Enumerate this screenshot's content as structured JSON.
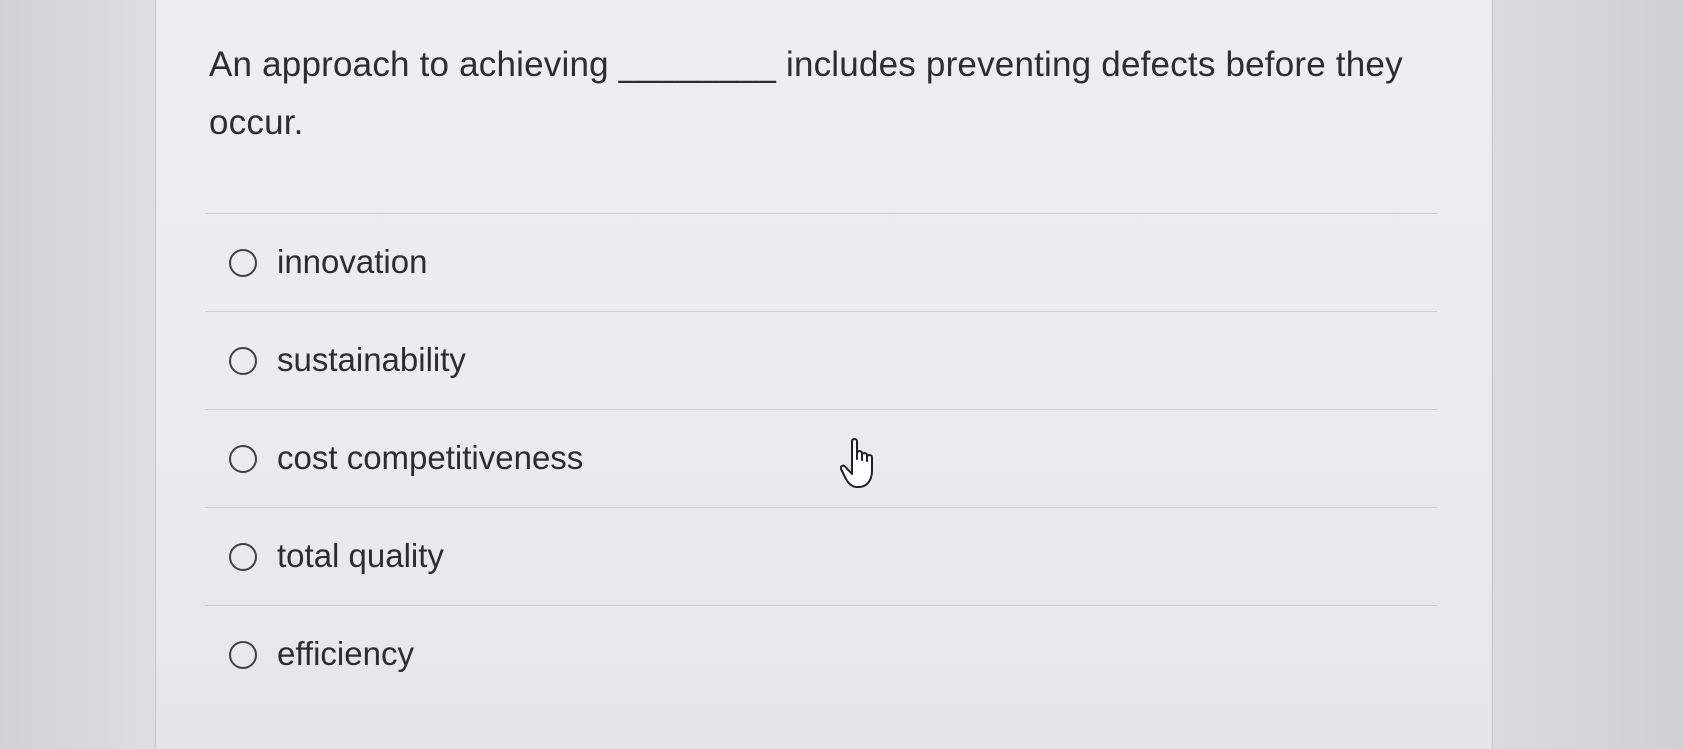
{
  "question": {
    "text": "An approach to achieving ________ includes preventing defects before they occur."
  },
  "options": [
    {
      "label": "innovation",
      "selected": false
    },
    {
      "label": "sustainability",
      "selected": false
    },
    {
      "label": "cost competitiveness",
      "selected": false
    },
    {
      "label": "total quality",
      "selected": false
    },
    {
      "label": "efficiency",
      "selected": false
    }
  ],
  "cursor": {
    "icon": "hand-pointer-icon"
  }
}
